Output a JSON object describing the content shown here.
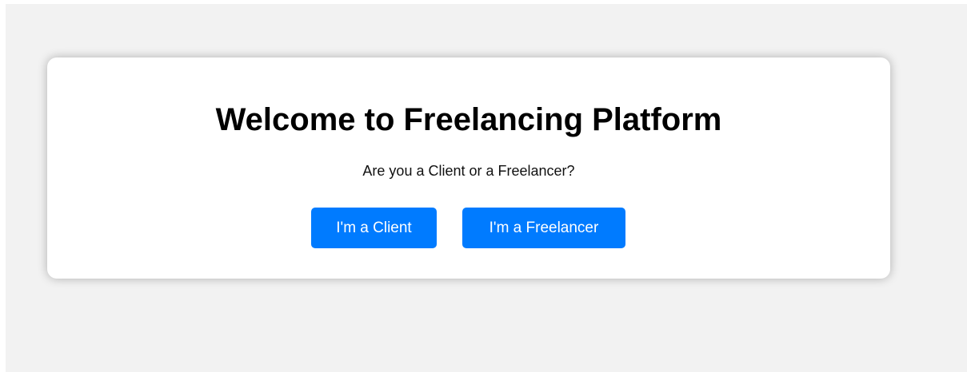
{
  "welcome": {
    "title": "Welcome to Freelancing Platform",
    "question": "Are you a Client or a Freelancer?",
    "client_button": "I'm a Client",
    "freelancer_button": "I'm a Freelancer"
  },
  "colors": {
    "background": "#f2f2f2",
    "card": "#ffffff",
    "button": "#007bff",
    "button_text": "#ffffff"
  }
}
